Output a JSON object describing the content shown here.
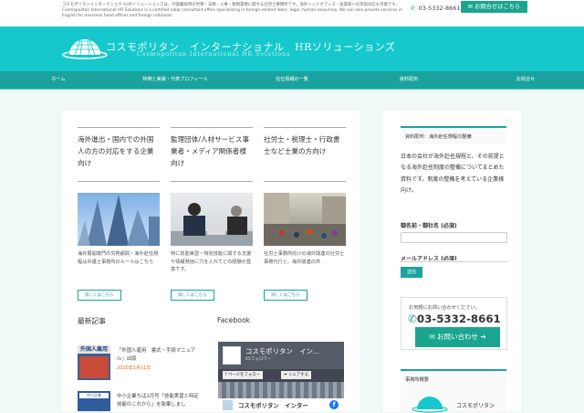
{
  "topbar": {
    "description": "コスモポリタンインターナショナルHRソリューションズは、外国籍採用の労務・法務・人事・税務業務に関する社労士事務所です。海外ヘッドオフィス・役業者への英語対応も可能です。 Cosmopolitan International HR Solutions is a certified labor consultant office specializing in foreign-related labor, legal, human resources. We can also provide services in English for overseas head offices and foreign nationals.",
    "phone": "03-5332-8661",
    "contact_button": "お問合せはこちら"
  },
  "header": {
    "brand_jp": "コスモポリタン　インターナショナル　HRソリューションズ",
    "brand_en": "Cosmopolitan International HR Solutions"
  },
  "nav": [
    "ホーム",
    "特徴と実績・代表プロフィール",
    "在位情報の一覧",
    "資料配布",
    "お問合せ"
  ],
  "columns": [
    {
      "title": "海外進出・国内での外国人の方の対応をする企業向け",
      "text": "海外展開専門の労務顧問・海外赴任規程は弁護士事務所のルールはこちら",
      "button": "詳しくはこちら"
    },
    {
      "title": "監理団体/人材サービス事業者・メディア関係者様向け",
      "text": "特に技能実習・特定技能に関する支援や情報発信に力を入れてどの経験が豊富です。",
      "button": "詳しくはこちら"
    },
    {
      "title": "社労士・税理士・行政書士など士業の方向け",
      "text": "社労士事務所向けの海外関連の社労士事務代行と、海外関連の供",
      "button": "詳しくはこちら"
    }
  ],
  "latest": {
    "heading": "最新記事",
    "posts": [
      {
        "thumb": "外国人雇用",
        "title": "「外国人雇用　書式・手続マニュアル」出版",
        "date": "2020年1月11日"
      },
      {
        "thumb": "中小企業",
        "title": "中小企業ちば2月号「技能実習と特定技能のこれから」を執筆しまし"
      }
    ]
  },
  "facebook": {
    "heading": "Facebook",
    "page_name": "コスモポリタン　イン...",
    "page_sub": "65フォロワー",
    "like": "ページをフォロー",
    "share": "シェアする",
    "footer_name": "コスモポリタン　インター"
  },
  "sidebar": {
    "box_title": "資料配布：海外赴任規程の整備",
    "intro": "日本の会社が海外赴任規程と、その前提となる海外赴任制度の整備についてまとめた資料です。制度の整備を考えている企業様向け。",
    "name_label": "御名前・御社名 (必須)",
    "email_label": "メールアドレス (必須)",
    "send": "送信",
    "contact_question": "お気軽にお問い合わせください。",
    "contact_phone": "03-5332-8661",
    "contact_mail": "お問い合わせ",
    "office_title": "事務所概要",
    "office_name": "コスモポリタン"
  }
}
